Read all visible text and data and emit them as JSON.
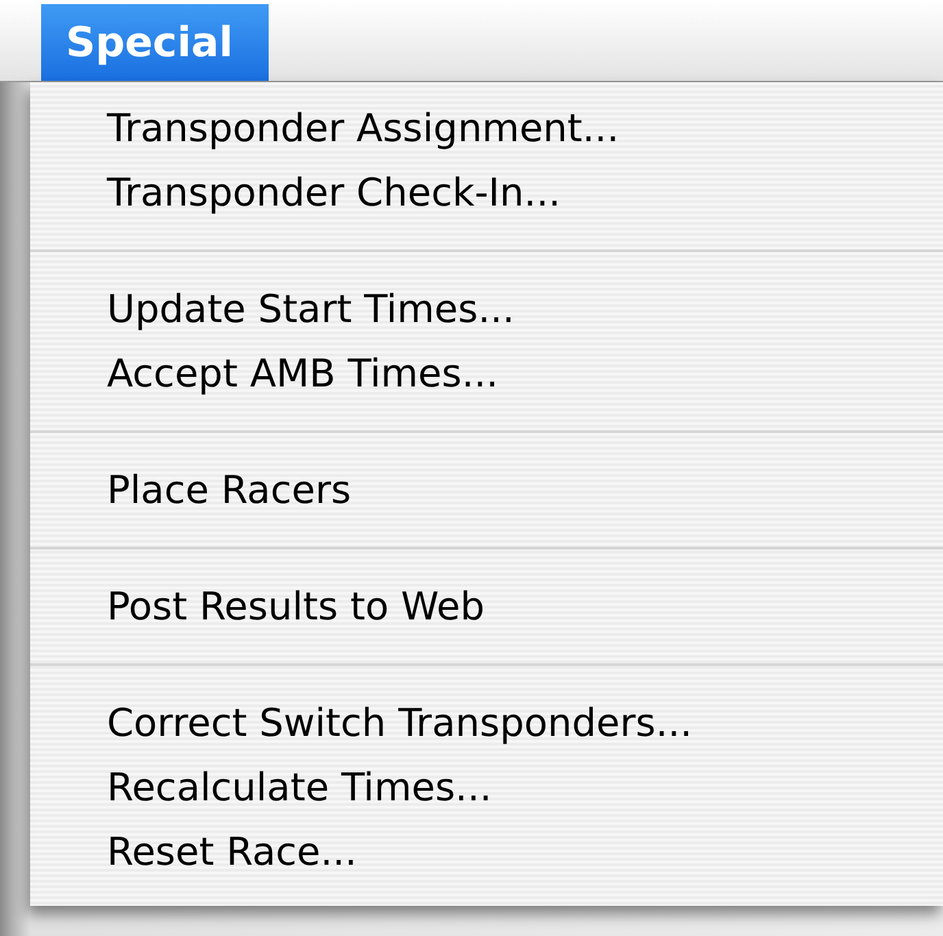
{
  "menubar": [
    {
      "label": "Special",
      "selected": true
    }
  ],
  "menu": [
    {
      "kind": "item",
      "label": "Transponder Assignment..."
    },
    {
      "kind": "item",
      "label": "Transponder Check-In..."
    },
    {
      "kind": "separator"
    },
    {
      "kind": "item",
      "label": "Update Start Times..."
    },
    {
      "kind": "item",
      "label": "Accept AMB Times..."
    },
    {
      "kind": "separator"
    },
    {
      "kind": "item",
      "label": "Place Racers"
    },
    {
      "kind": "separator"
    },
    {
      "kind": "item",
      "label": "Post Results to Web"
    },
    {
      "kind": "separator"
    },
    {
      "kind": "item",
      "label": "Correct Switch Transponders..."
    },
    {
      "kind": "item",
      "label": "Recalculate Times..."
    },
    {
      "kind": "item",
      "label": "Reset Race..."
    }
  ]
}
